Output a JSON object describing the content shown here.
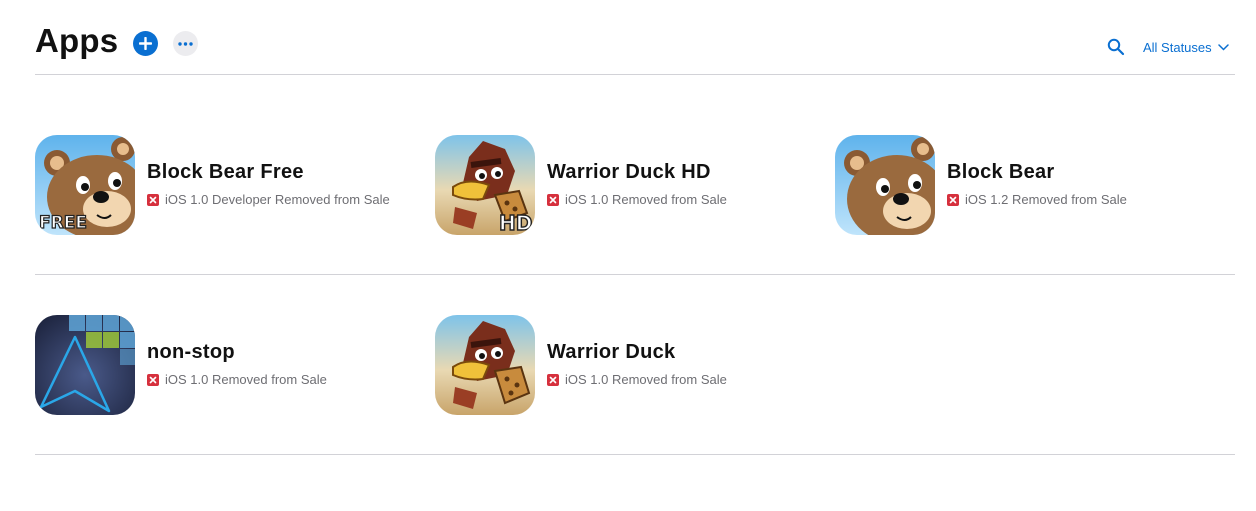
{
  "header": {
    "title": "Apps",
    "add_icon": "plus-circle-icon",
    "more_icon": "ellipsis-icon",
    "search_icon": "search-icon",
    "status_filter": "All Statuses"
  },
  "colors": {
    "accent": "#0a6fd1",
    "removed_badge": "#d6303d",
    "divider": "#d2d2d7"
  },
  "apps": [
    {
      "name": "Block Bear Free",
      "platform": "iOS 1.0",
      "status": "Developer Removed from Sale",
      "icon": "bear-icon",
      "icon_badge": "FREE"
    },
    {
      "name": "Warrior Duck HD",
      "platform": "iOS 1.0",
      "status": "Removed from Sale",
      "icon": "duck-icon",
      "icon_badge": "HD"
    },
    {
      "name": "Block Bear",
      "platform": "iOS 1.2",
      "status": "Removed from Sale",
      "icon": "bear-icon",
      "icon_badge": ""
    },
    {
      "name": "non-stop",
      "platform": "iOS 1.0",
      "status": "Removed from Sale",
      "icon": "arrow-blocks-icon",
      "icon_badge": ""
    },
    {
      "name": "Warrior Duck",
      "platform": "iOS 1.0",
      "status": "Removed from Sale",
      "icon": "duck-icon",
      "icon_badge": ""
    }
  ]
}
